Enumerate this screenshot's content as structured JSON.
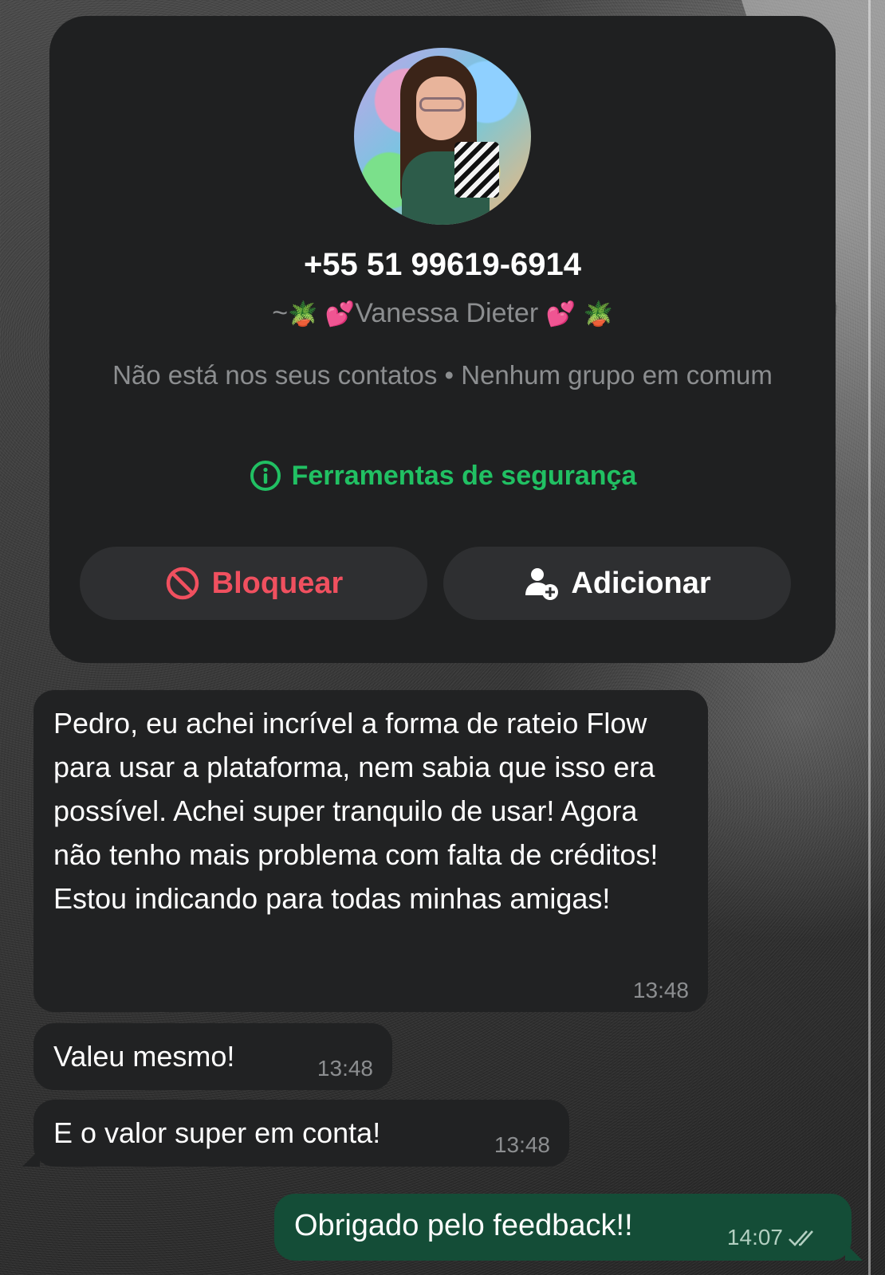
{
  "contact_card": {
    "phone": "+55 51 99619-6914",
    "name_prefix": "~",
    "plant_emoji": "🪴",
    "heart_emoji": "💕",
    "display_name": "Vanessa Dieter",
    "context": "Não está nos seus contatos • Nenhum grupo em comum",
    "safety_tools": "Ferramentas de segurança",
    "block_label": "Bloquear",
    "add_label": "Adicionar",
    "colors": {
      "safety": "#21c063",
      "block": "#f0505f"
    }
  },
  "messages": [
    {
      "direction": "incoming",
      "text": "Pedro, eu achei incrível a forma de rateio Flow para usar a plataforma, nem sabia que isso era possível. Achei super tranquilo de usar! Agora não tenho mais problema com falta de créditos! Estou indicando para todas minhas amigas!",
      "time": "13:48"
    },
    {
      "direction": "incoming",
      "text": "Valeu mesmo!",
      "time": "13:48"
    },
    {
      "direction": "incoming",
      "text": "E o valor super em conta!",
      "time": "13:48"
    },
    {
      "direction": "outgoing",
      "text": "Obrigado pelo feedback!!",
      "time": "14:07",
      "status": "read"
    }
  ]
}
